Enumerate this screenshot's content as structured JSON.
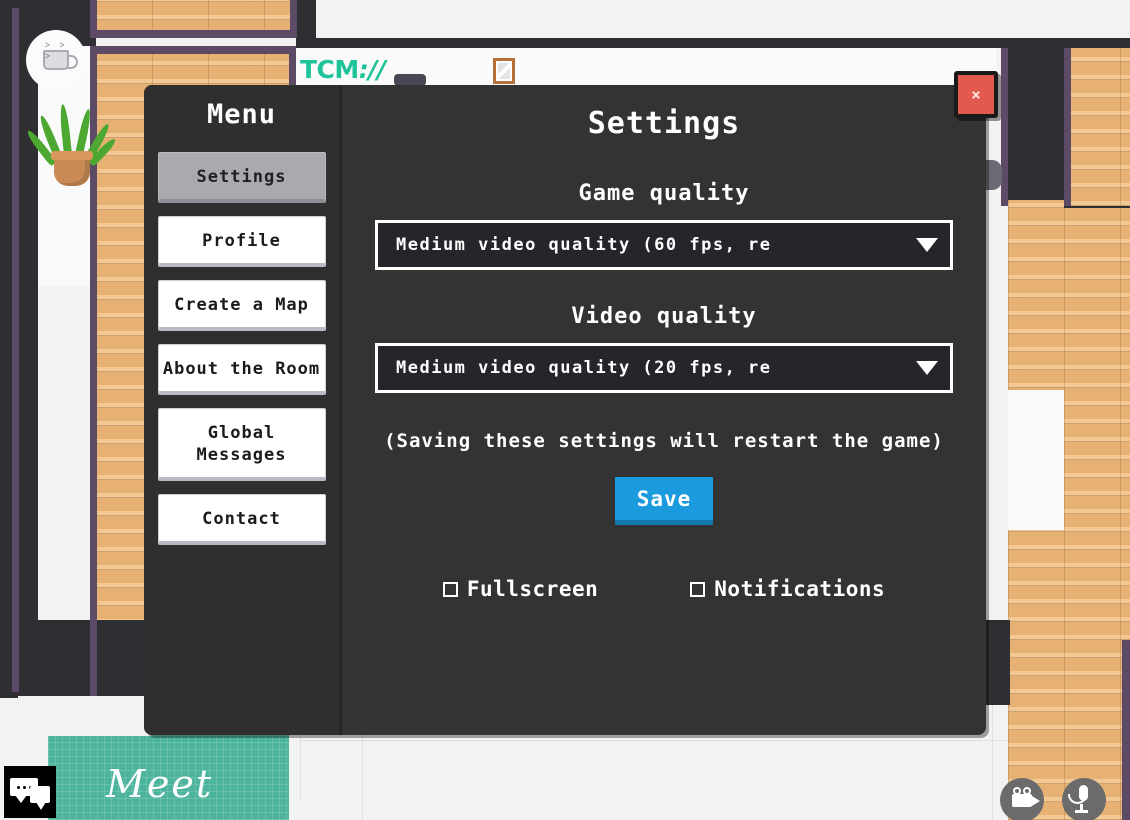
{
  "app": {
    "logo_text_primary": "TCM",
    "logo_text_accent": "://",
    "carpet_label": "Meet",
    "accent_color": "#1fc39a",
    "carpet_color": "#4cb49c",
    "floor_color": "#e7b173"
  },
  "modal": {
    "close_label": "×",
    "sidebar": {
      "title": "Menu",
      "items": [
        {
          "label": "Settings",
          "active": true
        },
        {
          "label": "Profile",
          "active": false
        },
        {
          "label": "Create a Map",
          "active": false
        },
        {
          "label": "About the Room",
          "active": false
        },
        {
          "label": "Global Messages",
          "active": false
        },
        {
          "label": "Contact",
          "active": false
        }
      ]
    },
    "content": {
      "title": "Settings",
      "game_quality": {
        "label": "Game quality",
        "value": "Medium video quality (60 fps, re",
        "arrow": "chevron-down-icon"
      },
      "video_quality": {
        "label": "Video quality",
        "value": "Medium video quality (20 fps, re",
        "arrow": "chevron-down-icon"
      },
      "note": "(Saving these settings will restart the game)",
      "save_label": "Save",
      "save_color": "#1c9ade",
      "checkboxes": [
        {
          "label": "Fullscreen",
          "checked": false
        },
        {
          "label": "Notifications",
          "checked": false
        }
      ]
    }
  },
  "toolbar": {
    "chat_icon": "chat-bubbles-icon",
    "camera_icon": "video-camera-icon",
    "microphone_icon": "microphone-icon"
  },
  "scene": {
    "avatar_icon": "coffee-mug-avatar",
    "steam_text": "˃ ˃ ˃",
    "plant_icon": "potted-plant",
    "picture_icon": "wall-picture-frame"
  }
}
